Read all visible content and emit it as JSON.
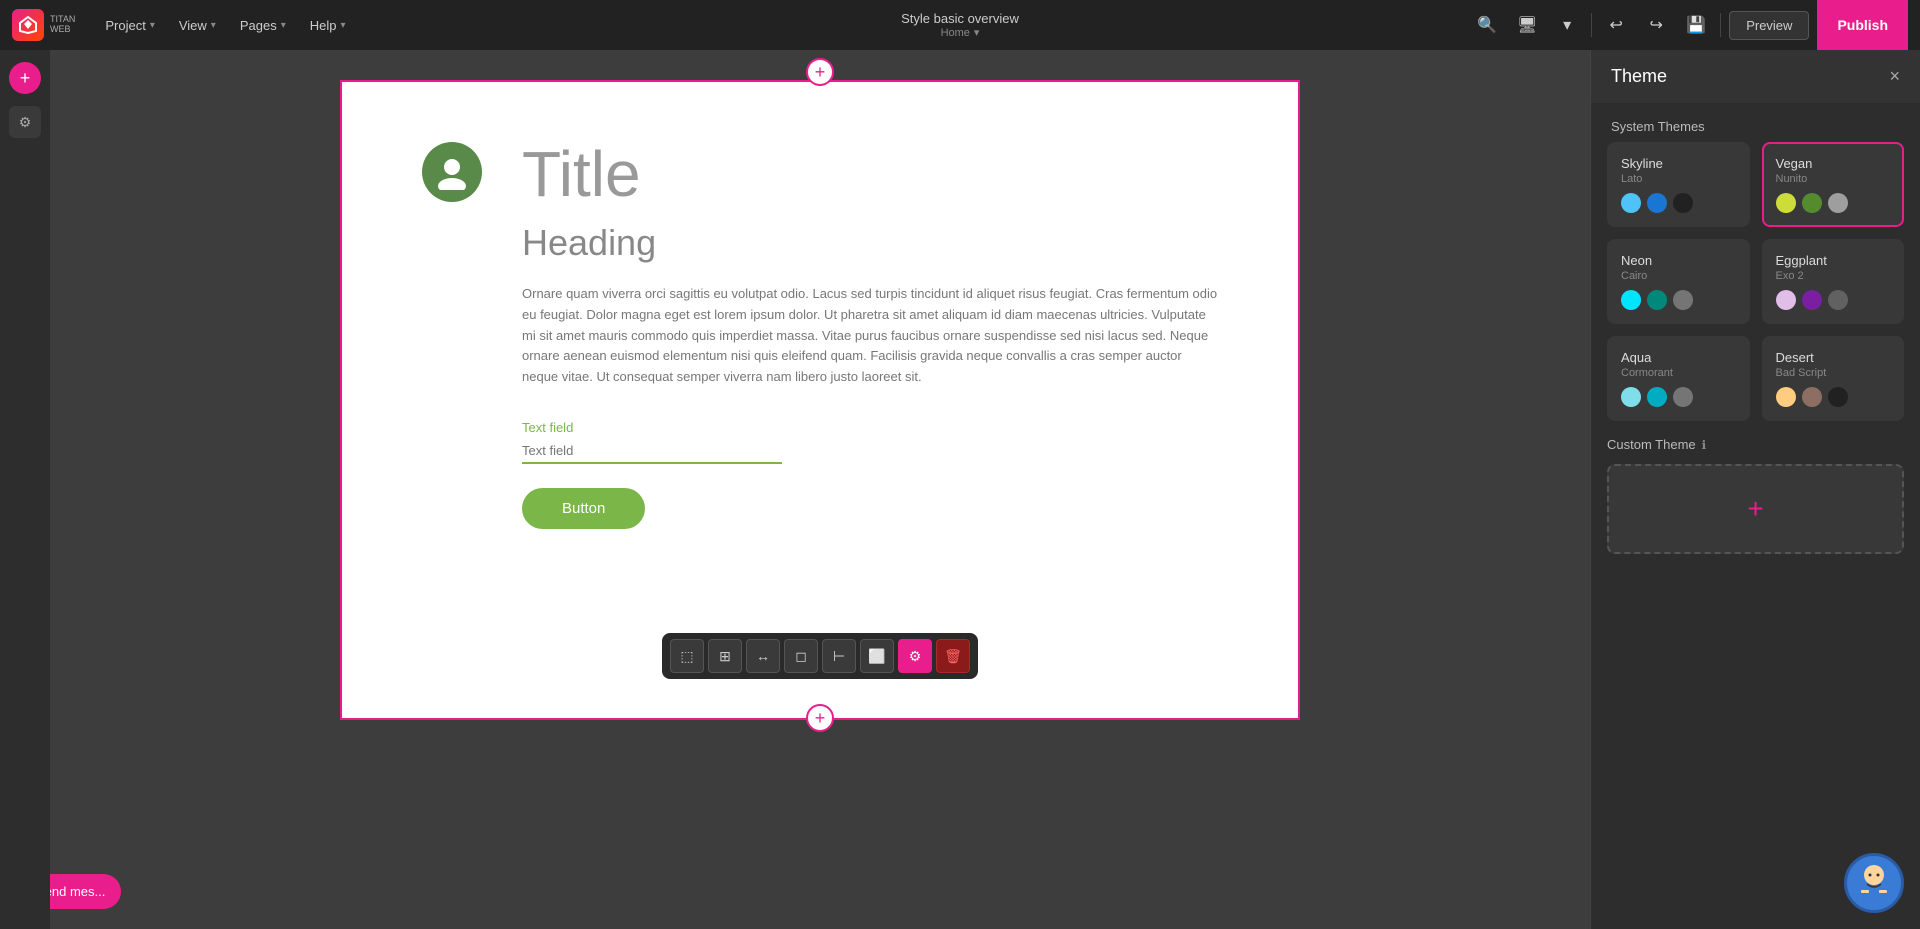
{
  "nav": {
    "logo_text": "TITAN",
    "logo_sub": "WEB",
    "menu_items": [
      {
        "label": "Project",
        "has_arrow": true
      },
      {
        "label": "View",
        "has_arrow": true
      },
      {
        "label": "Pages",
        "has_arrow": true
      },
      {
        "label": "Help",
        "has_arrow": true
      }
    ],
    "center_title": "Style basic overview",
    "center_sub": "Home",
    "preview_label": "Preview",
    "publish_label": "Publish"
  },
  "canvas": {
    "title": "Title",
    "heading": "Heading",
    "body_text": "Ornare quam viverra orci sagittis eu volutpat odio. Lacus sed turpis tincidunt id aliquet risus feugiat. Cras fermentum odio eu feugiat. Dolor magna eget est lorem ipsum dolor. Ut pharetra sit amet aliquam id diam maecenas ultricies. Vulputate mi sit amet mauris commodo quis imperdiet massa. Vitae purus faucibus ornare suspendisse sed nisi lacus sed. Neque ornare aenean euismod elementum nisi quis eleifend quam. Facilisis gravida neque convallis a cras semper auctor neque vitae. Ut consequat semper viverra nam libero justo laoreet sit.",
    "text_field_label": "Text field",
    "text_field_placeholder": "Text field",
    "button_label": "Button"
  },
  "theme_panel": {
    "title": "Theme",
    "close_label": "×",
    "system_themes_label": "System Themes",
    "custom_theme_label": "Custom Theme",
    "themes": [
      {
        "name": "Skyline",
        "font": "Lato",
        "selected": false,
        "colors": [
          "#4fc3f7",
          "#1976d2",
          "#212121"
        ]
      },
      {
        "name": "Vegan",
        "font": "Nunito",
        "selected": true,
        "colors": [
          "#cddc39",
          "#558b2f",
          "#9e9e9e"
        ]
      },
      {
        "name": "Neon",
        "font": "Cairo",
        "selected": false,
        "colors": [
          "#00e5ff",
          "#00897b",
          "#757575"
        ]
      },
      {
        "name": "Eggplant",
        "font": "Exo 2",
        "selected": false,
        "colors": [
          "#e1bee7",
          "#7b1fa2",
          "#616161"
        ]
      },
      {
        "name": "Aqua",
        "font": "Cormorant",
        "selected": false,
        "colors": [
          "#80deea",
          "#00acc1",
          "#757575"
        ]
      },
      {
        "name": "Desert",
        "font": "Bad Script",
        "selected": false,
        "colors": [
          "#ffcc80",
          "#8d6e63",
          "#212121"
        ]
      }
    ]
  },
  "toolbar": {
    "buttons": [
      {
        "name": "dashed-select",
        "icon": "⬚",
        "active": false
      },
      {
        "name": "grid-select",
        "icon": "⊞",
        "active": false
      },
      {
        "name": "move",
        "icon": "↔",
        "active": false
      },
      {
        "name": "resize",
        "icon": "⬛",
        "active": false
      },
      {
        "name": "align-left",
        "icon": "⊢",
        "active": false
      },
      {
        "name": "external",
        "icon": "⬜",
        "active": false
      },
      {
        "name": "settings",
        "icon": "⚙",
        "active": true
      },
      {
        "name": "delete",
        "icon": "🗑",
        "active": false,
        "danger": true
      }
    ]
  },
  "chat": {
    "label": "Send mes..."
  }
}
